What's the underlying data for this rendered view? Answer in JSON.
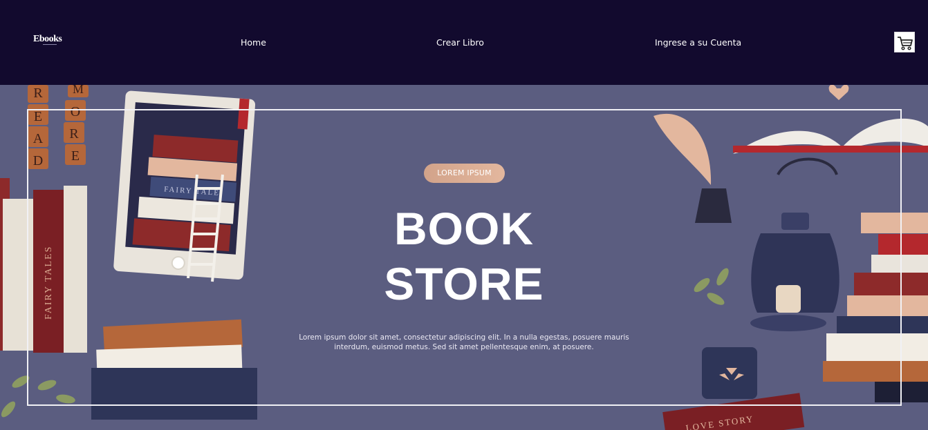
{
  "brand": {
    "logo_text": "Ebooks"
  },
  "nav": {
    "home_label": "Home",
    "create_label": "Crear Libro",
    "account_label": "Ingrese a su Cuenta",
    "cart_icon": "shopping-cart-icon"
  },
  "hero": {
    "badge": "LOREM IPSUM",
    "title_line1": "BOOK",
    "title_line2": "STORE",
    "description": "Lorem ipsum dolor sit amet, consectetur adipiscing elit. In a nulla egestas, posuere mauris interdum, euismod metus. Sed sit amet pellentesque enim, at posuere.",
    "tiles_read": [
      "R",
      "E",
      "A",
      "D"
    ],
    "tiles_more": [
      "M",
      "O",
      "R",
      "E"
    ],
    "book_spine_fairy_tales": "FAIRY TALES",
    "book_spine_fairy_tale": "FAIRY TALE",
    "book_spine_love_story": "LOVE STORY"
  },
  "colors": {
    "navbar_bg": "#120a2e",
    "hero_bg": "#5b5d80",
    "badge_from": "#d2a38a",
    "badge_to": "#e3b79e",
    "frame": "#f1f1f5"
  }
}
